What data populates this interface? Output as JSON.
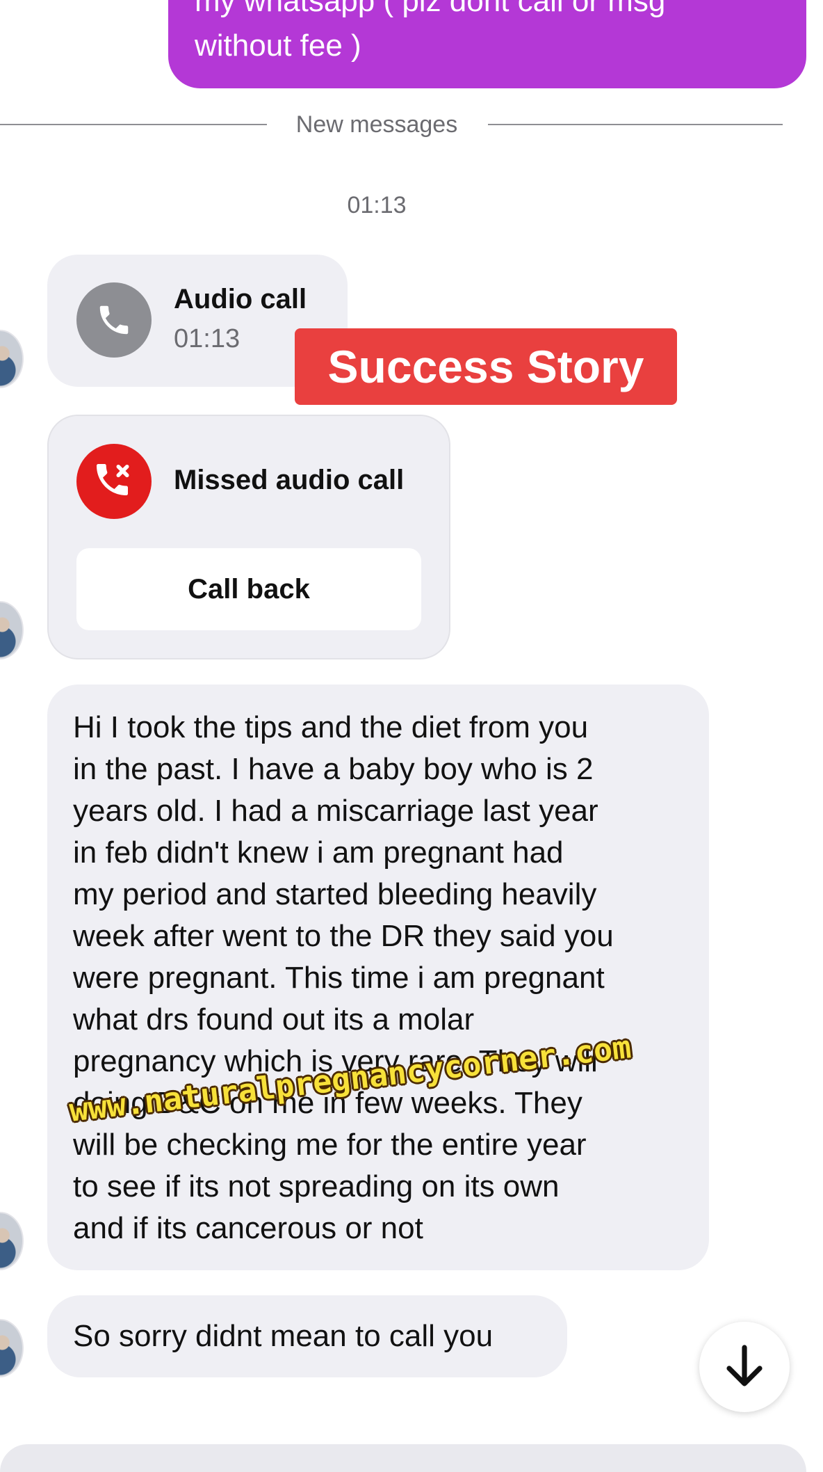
{
  "outgoing": {
    "line1": "my whatsapp ( plz dont call or msg",
    "line2": "without fee )"
  },
  "divider": {
    "label": "New messages"
  },
  "timestamp": "01:13",
  "audio_call": {
    "title": "Audio call",
    "duration": "01:13",
    "icon": "phone-icon"
  },
  "banner": {
    "text": "Success Story"
  },
  "missed_call": {
    "title": "Missed audio call",
    "button": "Call back",
    "icon": "missed-call-icon"
  },
  "long_message": {
    "lines": [
      "Hi I took the tips and the diet from you",
      "in the past. I have a baby boy who is 2",
      "years old. I had a miscarriage last year",
      "in feb didn't knew i am pregnant had",
      "my period and started bleeding heavily",
      "week after went to the DR they said you",
      "were pregnant.  This time i am pregnant",
      "what drs found out its a molar",
      "pregnancy which is very rare. They will",
      "doing D&C on me in few weeks. They",
      "will be checking me for the entire year",
      "to see if its not spreading on its own",
      "and if its cancerous or not"
    ]
  },
  "watermark": "www.naturalpregnancycorner.com",
  "sorry_message": "So sorry didnt mean to call you",
  "scroll_button": {
    "icon": "arrow-down-icon"
  },
  "colors": {
    "outgoing_bubble": "#b438d6",
    "incoming_bubble": "#efeff4",
    "banner": "#e9403f",
    "missed_call_icon": "#e21d1d",
    "call_icon": "#8d8e93",
    "watermark": "#f7e13a"
  }
}
